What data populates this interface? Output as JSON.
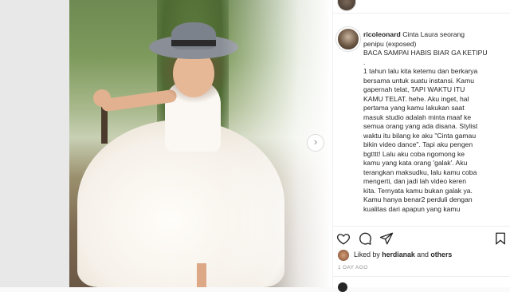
{
  "post": {
    "author": "ricoleonard",
    "caption_lines": [
      "Cinta Laura seorang",
      "penipu (exposed)",
      "BACA SAMPAI HABIS BIAR GA KETIPU",
      ".",
      "1 tahun lalu kita ketemu dan berkarya",
      "bersama untuk suatu instansi. Kamu",
      "gapernah telat, TAPI WAKTU ITU",
      "KAMU TELAT. hehe. Aku inget, hal",
      "pertama yang kamu lakukan saat",
      "masuk studio adalah minta maaf ke",
      "semua orang yang ada disana. Stylist",
      "waktu itu bilang ke aku \"Cinta gamau",
      "bikin video dance\". Tapi aku pengen",
      "bgtttt! Lalu aku coba ngomong ke",
      "kamu yang kata orang 'galak'. Aku",
      "terangkan maksudku, lalu kamu coba",
      "mengerti, dan jadi lah video keren",
      "kita. Ternyata kamu bukan galak ya.",
      "Kamu hanya benar2 perduli dengan",
      "kualitas dari apapun yang kamu"
    ],
    "liked_by_prefix": "Liked by",
    "liked_by_user": "herdianak",
    "liked_by_suffix": "and",
    "liked_by_others": "others",
    "timestamp": "1 DAY AGO"
  },
  "icons": {
    "like": "heart-icon",
    "comment": "comment-icon",
    "share": "paper-plane-icon",
    "save": "bookmark-icon",
    "next": "chevron-right-icon"
  },
  "colors": {
    "text": "#262626",
    "muted": "#8e8e8e",
    "border": "#dbdbdb"
  }
}
